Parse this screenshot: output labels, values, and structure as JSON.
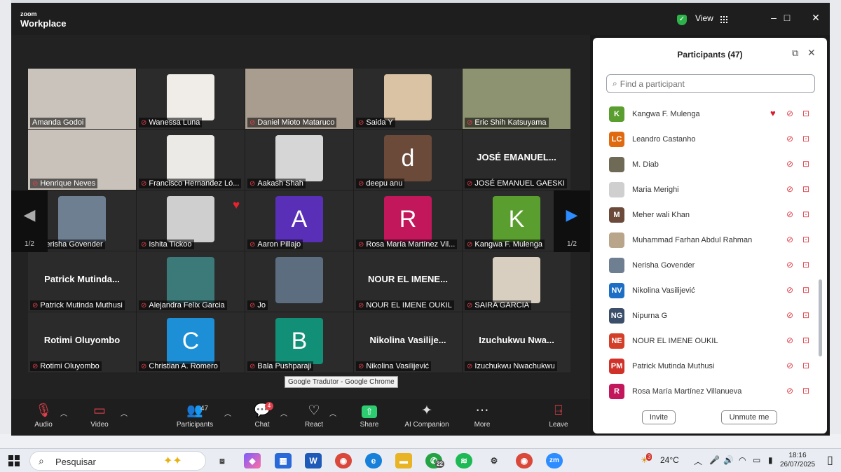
{
  "window": {
    "brand_line1": "zoom",
    "brand_line2": "Workplace",
    "view_label": "View",
    "controls": {
      "minimize": "–",
      "maximize": "□",
      "close": "✕"
    }
  },
  "gallery": {
    "page_indicator": "1/2",
    "tiles": [
      {
        "label": "Amanda Godoi",
        "mic_off": false,
        "kind": "photo",
        "bg": "#c9c3bb",
        "active": true
      },
      {
        "label": "Wanessa Luna",
        "mic_off": true,
        "kind": "photo",
        "bg": "#f0ede8"
      },
      {
        "label": "Daniel Mioto Mataruco",
        "mic_off": true,
        "kind": "photo",
        "bg": "#a99d90"
      },
      {
        "label": "Saida Y",
        "mic_off": true,
        "kind": "photo",
        "bg": "#d9c3a4"
      },
      {
        "label": "Eric Shih Katsuyama",
        "mic_off": true,
        "kind": "photo",
        "bg": "#8d9270"
      },
      {
        "label": "Henrique Neves",
        "mic_off": true,
        "kind": "photo",
        "bg": "#c8c2ba"
      },
      {
        "label": "Francisco Hernandez Ló...",
        "mic_off": true,
        "kind": "photo",
        "bg": "#eceae6"
      },
      {
        "label": "Aakash Shah",
        "mic_off": true,
        "kind": "photo",
        "bg": "#d6d6d6"
      },
      {
        "label": "deepu anu",
        "mic_off": true,
        "kind": "avatar",
        "letter": "d",
        "color": "#6b4a3a"
      },
      {
        "label": "JOSÉ  EMANUEL GAESKI",
        "mic_off": true,
        "kind": "name",
        "big": "JOSÉ  EMANUEL..."
      },
      {
        "label": "Nerisha Govender",
        "mic_off": true,
        "kind": "photo",
        "bg": "#6f7f92"
      },
      {
        "label": "Ishita Tickoo",
        "mic_off": true,
        "kind": "photo",
        "bg": "#cfcfcf"
      },
      {
        "label": "Aaron Pillajo",
        "mic_off": true,
        "kind": "avatar",
        "letter": "A",
        "color": "#5a2fb7"
      },
      {
        "label": "Rosa María Martínez Vil...",
        "mic_off": true,
        "kind": "avatar",
        "letter": "R",
        "color": "#c2185b"
      },
      {
        "label": "Kangwa F. Mulenga",
        "mic_off": true,
        "kind": "avatar",
        "letter": "K",
        "color": "#5a9e2f"
      },
      {
        "label": "Patrick Mutinda Muthusi",
        "mic_off": true,
        "kind": "name",
        "big": "Patrick  Mutinda..."
      },
      {
        "label": "Alejandra Felix Garcia",
        "mic_off": true,
        "kind": "photo",
        "bg": "#3c7a7a"
      },
      {
        "label": "Jo",
        "mic_off": true,
        "kind": "photo",
        "bg": "#5d6d80"
      },
      {
        "label": "NOUR EL IMENE OUKIL",
        "mic_off": true,
        "kind": "name",
        "big": "NOUR  EL  IMENE..."
      },
      {
        "label": "SAIRA GARCIA",
        "mic_off": true,
        "kind": "photo",
        "bg": "#d8cfc0"
      },
      {
        "label": "Rotimi Oluyombo",
        "mic_off": true,
        "kind": "name",
        "big": "Rotimi Oluyombo"
      },
      {
        "label": "Christian A. Romero",
        "mic_off": true,
        "kind": "avatar",
        "letter": "C",
        "color": "#1c8fd6"
      },
      {
        "label": "Bala Pushparaji",
        "mic_off": true,
        "kind": "avatar",
        "letter": "B",
        "color": "#119077"
      },
      {
        "label": "Nikolina Vasilijević",
        "mic_off": true,
        "kind": "name",
        "big": "Nikolina  Vasilije..."
      },
      {
        "label": "Izuchukwu Nwachukwu",
        "mic_off": true,
        "kind": "name",
        "big": "Izuchukwu  Nwa..."
      }
    ],
    "tooltip": "Google Tradutor - Google Chrome"
  },
  "toolbar": {
    "audio": "Audio",
    "video": "Video",
    "participants": "Participants",
    "participants_count": "47",
    "chat": "Chat",
    "chat_badge": "4",
    "react": "React",
    "share": "Share",
    "ai_companion": "AI Companion",
    "more": "More",
    "leave": "Leave"
  },
  "panel": {
    "title": "Participants (47)",
    "search_placeholder": "Find a participant",
    "invite": "Invite",
    "unmute_me": "Unmute me",
    "participants": [
      {
        "name": "Kangwa F. Mulenga",
        "initials": "K",
        "color": "#5a9e2f",
        "heart": true
      },
      {
        "name": "Leandro Castanho",
        "initials": "LC",
        "color": "#e06a10"
      },
      {
        "name": "M. Diab",
        "initials": "",
        "color": "#6f6a55"
      },
      {
        "name": "Maria Merighi",
        "initials": "",
        "color": "#cfcfcf"
      },
      {
        "name": "Meher wali Khan",
        "initials": "M",
        "color": "#6b4a3a"
      },
      {
        "name": "Muhammad Farhan Abdul Rahman",
        "initials": "",
        "color": "#b9a58a"
      },
      {
        "name": "Nerisha Govender",
        "initials": "",
        "color": "#6f7f92"
      },
      {
        "name": "Nikolina Vasilijević",
        "initials": "NV",
        "color": "#1c6fc4"
      },
      {
        "name": "Nipurna G",
        "initials": "NG",
        "color": "#3b4f6b"
      },
      {
        "name": "NOUR EL IMENE OUKIL",
        "initials": "NE",
        "color": "#d43f2a"
      },
      {
        "name": "Patrick Mutinda Muthusi",
        "initials": "PM",
        "color": "#d0322a"
      },
      {
        "name": "Rosa María Martínez Villanueva",
        "initials": "R",
        "color": "#c2185b"
      }
    ]
  },
  "taskbar": {
    "search_text": "Pesquisar",
    "whatsapp_badge": "22",
    "weather_badge": "3",
    "temperature": "24°C",
    "time": "18:16",
    "date": "26/07/2025"
  }
}
